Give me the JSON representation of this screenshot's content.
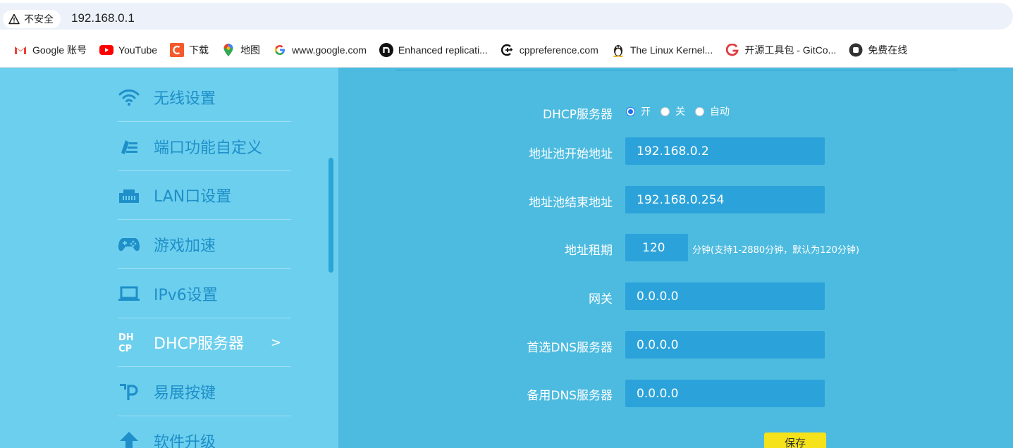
{
  "browser": {
    "security_label": "不安全",
    "url": "192.168.0.1"
  },
  "bookmarks": [
    {
      "label": "Google 账号",
      "icon": "gmail-icon"
    },
    {
      "label": "YouTube",
      "icon": "youtube-icon"
    },
    {
      "label": "下载",
      "icon": "download-c-icon"
    },
    {
      "label": "地图",
      "icon": "maps-pin-icon"
    },
    {
      "label": "www.google.com",
      "icon": "google-g-icon"
    },
    {
      "label": "Enhanced replicati...",
      "icon": "n-circle-icon"
    },
    {
      "label": "cppreference.com",
      "icon": "cpp-icon"
    },
    {
      "label": "The Linux Kernel...",
      "icon": "tux-icon"
    },
    {
      "label": "开源工具包 - GitCo...",
      "icon": "gitcode-icon"
    },
    {
      "label": "免费在线",
      "icon": "dark-circle-icon"
    }
  ],
  "sidebar": {
    "items": [
      {
        "label": "无线设置",
        "icon": "wifi-icon"
      },
      {
        "label": "端口功能自定义",
        "icon": "port-custom-icon"
      },
      {
        "label": "LAN口设置",
        "icon": "lan-port-icon"
      },
      {
        "label": "游戏加速",
        "icon": "gamepad-icon"
      },
      {
        "label": "IPv6设置",
        "icon": "laptop-icon"
      },
      {
        "label": "DHCP服务器",
        "icon": "dhcp-icon",
        "active": true,
        "arrow": ">"
      },
      {
        "label": "易展按键",
        "icon": "easymesh-icon"
      },
      {
        "label": "软件升级",
        "icon": "upgrade-arrow-icon"
      }
    ]
  },
  "form": {
    "dhcp_label": "DHCP服务器",
    "dhcp_options": [
      {
        "label": "开",
        "checked": true
      },
      {
        "label": "关",
        "checked": false
      },
      {
        "label": "自动",
        "checked": false
      }
    ],
    "pool_start_label": "地址池开始地址",
    "pool_start_value": "192.168.0.2",
    "pool_end_label": "地址池结束地址",
    "pool_end_value": "192.168.0.254",
    "lease_label": "地址租期",
    "lease_value": "120",
    "lease_hint": "分钟(支持1-2880分钟，默认为120分钟)",
    "gateway_label": "网关",
    "gateway_value": "0.0.0.0",
    "dns1_label": "首选DNS服务器",
    "dns1_value": "0.0.0.0",
    "dns2_label": "备用DNS服务器",
    "dns2_value": "0.0.0.0",
    "save_label": "保存"
  },
  "colors": {
    "sidebar_bg": "#6dcfee",
    "main_bg": "#4dbbe0",
    "field_bg": "#2ba3da",
    "nav_text": "#1e8fc8",
    "save_button": "#f5e21a"
  }
}
